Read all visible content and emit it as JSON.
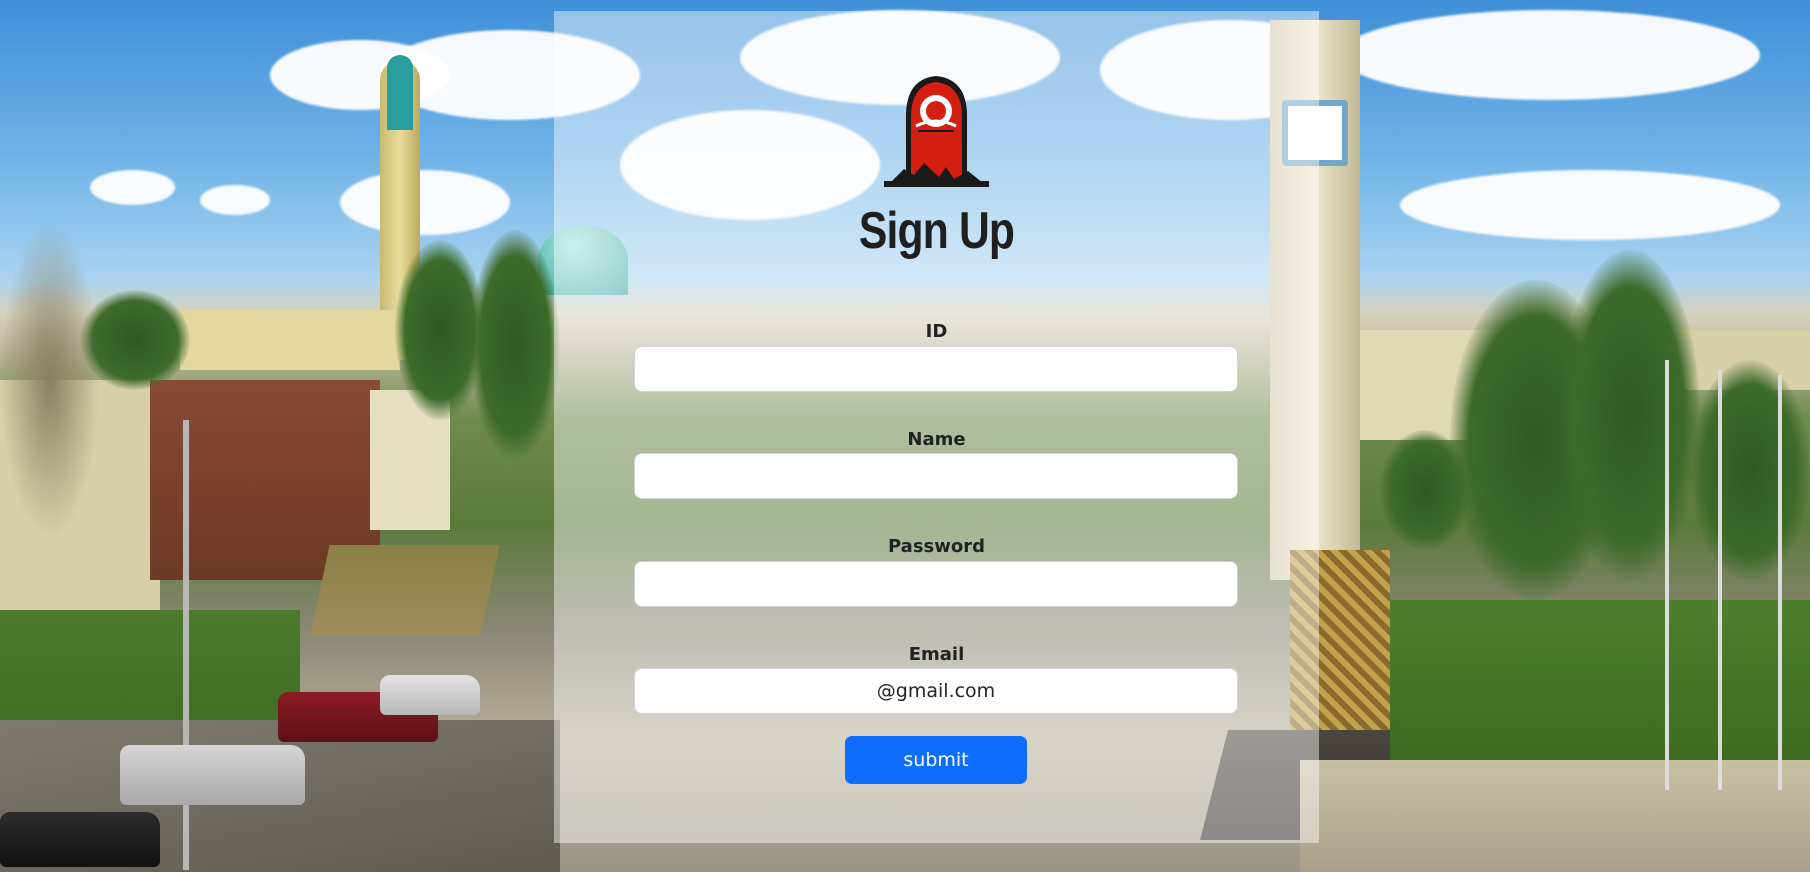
{
  "page": {
    "title": "Sign Up",
    "logo_icon": "mutah-university-logo-icon"
  },
  "form": {
    "fields": [
      {
        "label": "ID",
        "value": "",
        "placeholder": ""
      },
      {
        "label": "Name",
        "value": "",
        "placeholder": ""
      },
      {
        "label": "Password",
        "value": "",
        "placeholder": ""
      },
      {
        "label": "Email",
        "value": "@gmail.com",
        "placeholder": ""
      }
    ],
    "submit_label": "submit"
  },
  "colors": {
    "submit_button": "#0d6efd",
    "logo_red": "#d21f12",
    "title_text": "#1f1f1f"
  }
}
